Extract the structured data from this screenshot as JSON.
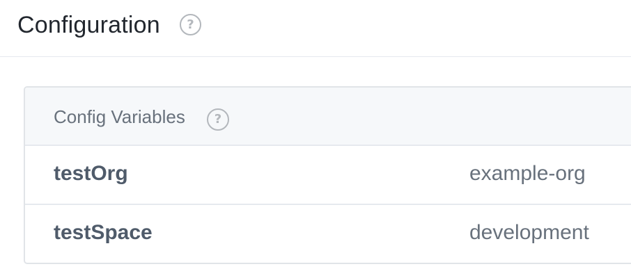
{
  "header": {
    "title": "Configuration",
    "help_icon": "question-circle-icon"
  },
  "config_card": {
    "title": "Config Variables",
    "help_icon": "question-circle-icon",
    "rows": [
      {
        "key": "testOrg",
        "value": "example-org"
      },
      {
        "key": "testSpace",
        "value": "development"
      }
    ]
  },
  "colors": {
    "title_text": "#22272e",
    "key_text": "#4f5b6a",
    "value_text": "#68717c",
    "card_header_bg": "#f6f8fa",
    "border": "#e1e4e8",
    "help_icon": "#b3b7bc"
  }
}
